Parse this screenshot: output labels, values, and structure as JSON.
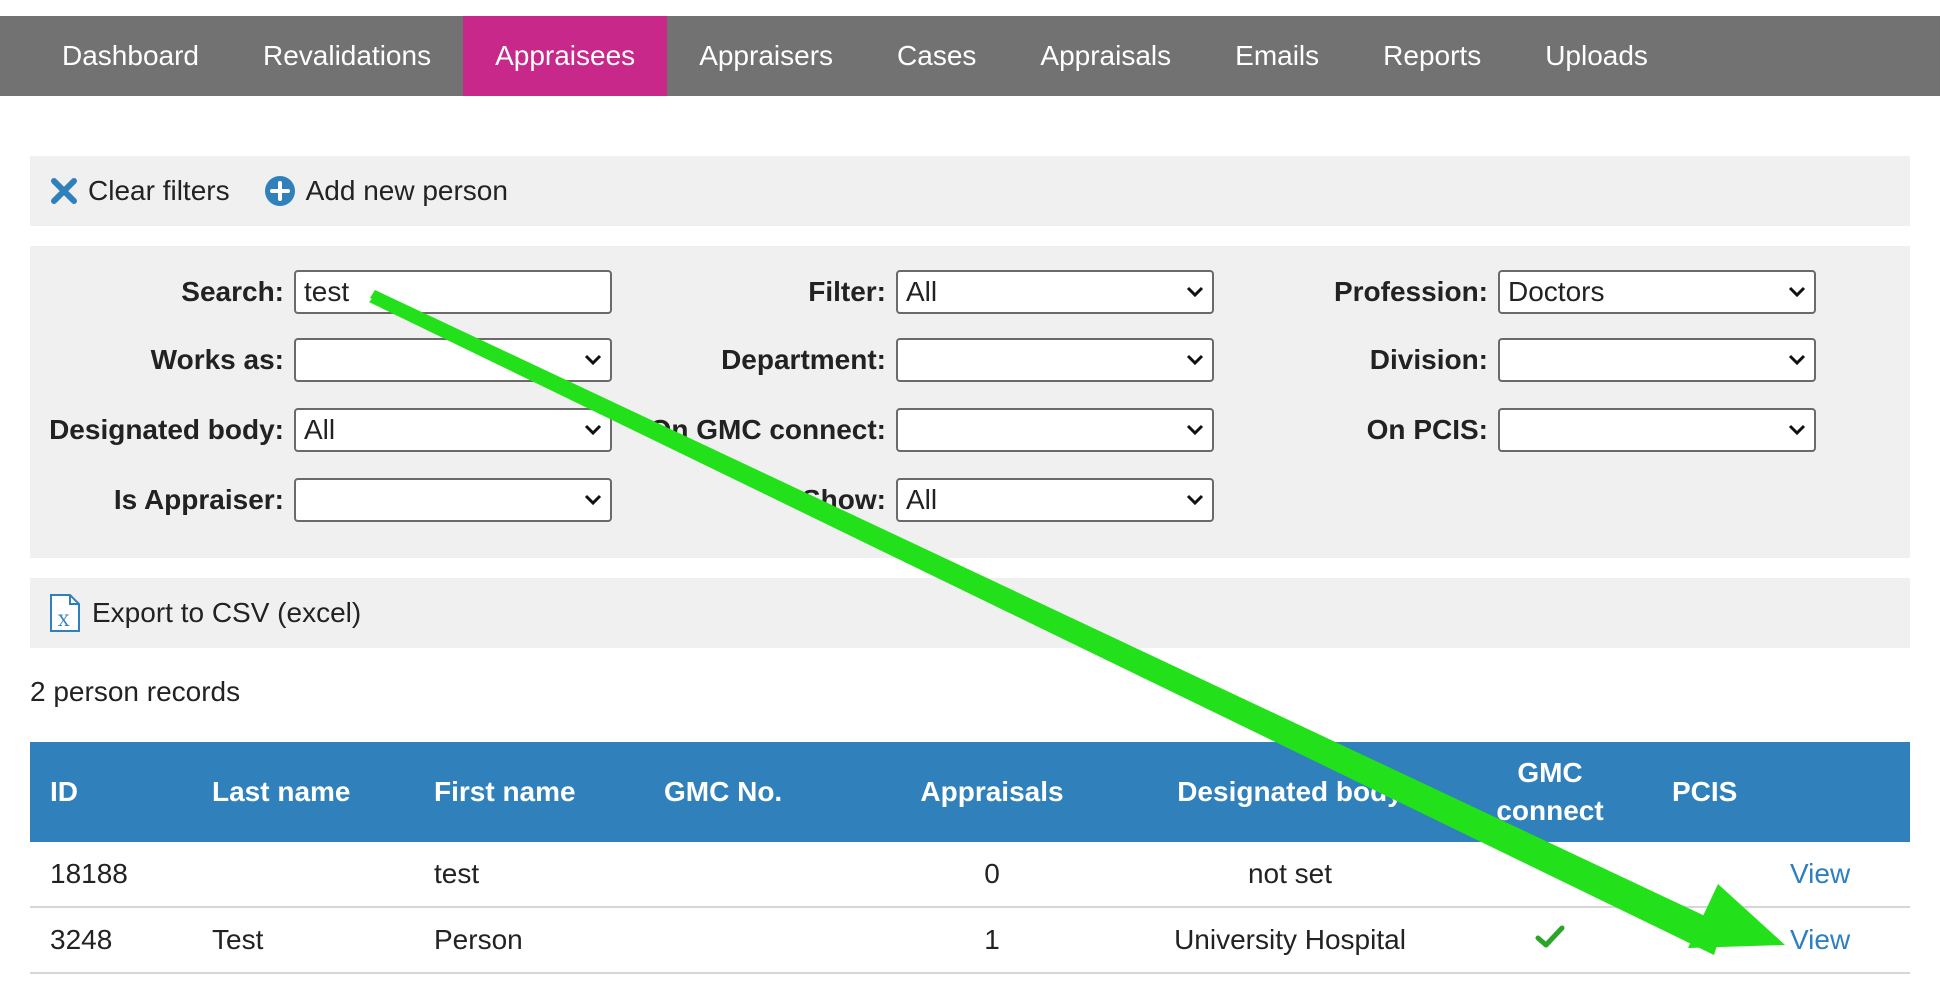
{
  "nav": {
    "items": [
      {
        "label": "Dashboard"
      },
      {
        "label": "Revalidations"
      },
      {
        "label": "Appraisees"
      },
      {
        "label": "Appraisers"
      },
      {
        "label": "Cases"
      },
      {
        "label": "Appraisals"
      },
      {
        "label": "Emails"
      },
      {
        "label": "Reports"
      },
      {
        "label": "Uploads"
      }
    ],
    "active": "Appraisees"
  },
  "actions": {
    "clear_filters": "Clear filters",
    "add_person": "Add new person",
    "export_csv": "Export to CSV (excel)"
  },
  "filters": {
    "search": {
      "label": "Search:",
      "value": "test"
    },
    "works_as": {
      "label": "Works as:",
      "value": ""
    },
    "designated_body": {
      "label": "Designated body:",
      "value": "All"
    },
    "is_appraiser": {
      "label": "Is Appraiser:",
      "value": ""
    },
    "filter": {
      "label": "Filter:",
      "value": "All"
    },
    "department": {
      "label": "Department:",
      "value": ""
    },
    "on_gmc_connect": {
      "label": "On GMC connect:",
      "value": ""
    },
    "show": {
      "label": "Show:",
      "value": "All"
    },
    "profession": {
      "label": "Profession:",
      "value": "Doctors"
    },
    "division": {
      "label": "Division:",
      "value": ""
    },
    "on_pcis": {
      "label": "On PCIS:",
      "value": ""
    }
  },
  "records_count": "2 person records",
  "table": {
    "headers": {
      "id": "ID",
      "last_name": "Last name",
      "first_name": "First name",
      "gmc_no": "GMC No.",
      "appraisals": "Appraisals",
      "designated_body": "Designated body",
      "gmc_connect_line1": "GMC",
      "gmc_connect_line2": "connect",
      "pcis": "PCIS"
    },
    "rows": [
      {
        "id": "18188",
        "last_name": "",
        "first_name": "test",
        "gmc_no": "",
        "appraisals": "0",
        "designated_body": "not set",
        "gmc_connect": false,
        "pcis": "",
        "action": "View"
      },
      {
        "id": "3248",
        "last_name": "Test",
        "first_name": "Person",
        "gmc_no": "",
        "appraisals": "1",
        "designated_body": "University Hospital",
        "gmc_connect": true,
        "pcis": "",
        "action": "View"
      }
    ]
  },
  "colors": {
    "nav_bg": "#727272",
    "nav_active": "#c8288a",
    "table_header": "#2f80bb",
    "link": "#2e7fbf",
    "annotation_arrow": "#22e01a",
    "check": "#2aa52a"
  }
}
